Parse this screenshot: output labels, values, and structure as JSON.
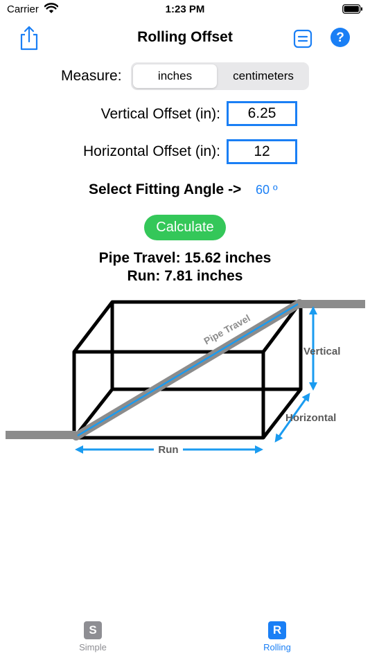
{
  "status_bar": {
    "carrier": "Carrier",
    "time": "1:23 PM"
  },
  "nav": {
    "title": "Rolling Offset",
    "share_icon": "share-icon",
    "list_icon": "list-icon",
    "help_label": "?"
  },
  "measure": {
    "label": "Measure:",
    "options": [
      "inches",
      "centimeters"
    ],
    "selected": "inches"
  },
  "vertical_offset": {
    "label": "Vertical Offset (in):",
    "value": "6.25"
  },
  "horizontal_offset": {
    "label": "Horizontal Offset (in):",
    "value": "12"
  },
  "fitting_angle": {
    "label": "Select Fitting Angle ->",
    "value": "60 º"
  },
  "calculate": {
    "label": "Calculate"
  },
  "results": {
    "pipe_travel": "Pipe Travel: 15.62 inches",
    "run": "Run: 7.81 inches"
  },
  "diagram": {
    "pipe_travel_label": "Pipe Travel",
    "vertical_label": "Vertical",
    "horizontal_label": "Horizontal",
    "run_label": "Run"
  },
  "tabs": [
    {
      "icon_letter": "S",
      "label": "Simple",
      "selected": false
    },
    {
      "icon_letter": "R",
      "label": "Rolling",
      "selected": true
    }
  ],
  "colors": {
    "accent": "#1a7ff5",
    "calculate_green": "#34c759",
    "pipe_gray": "#8c8c8c",
    "arrow_blue": "#1a9bf0",
    "tab_inactive": "#8e8e93"
  }
}
